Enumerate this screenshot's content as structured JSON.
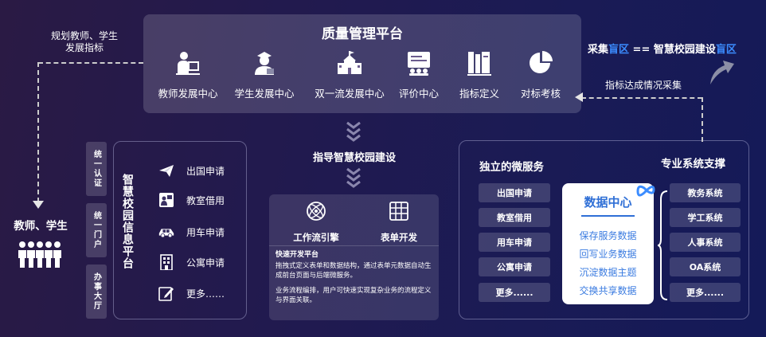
{
  "platform": {
    "title": "质量管理平台",
    "items": [
      {
        "label": "教师发展中心",
        "icon": "teacher-icon"
      },
      {
        "label": "学生发展中心",
        "icon": "student-icon"
      },
      {
        "label": "双一流发展中心",
        "icon": "school-building-icon"
      },
      {
        "label": "评价中心",
        "icon": "evaluation-icon"
      },
      {
        "label": "指标定义",
        "icon": "books-icon"
      },
      {
        "label": "对标考核",
        "icon": "pie-chart-icon"
      }
    ]
  },
  "left_note": {
    "line1": "规划教师、学生",
    "line2": "发展指标"
  },
  "right_note": {
    "collect_prefix": "采集",
    "collect_blind": "盲区",
    "collect_equals": " == ",
    "collect_build": "智慧校园建设",
    "collect_blind2": "盲区",
    "indicator": "指标达成情况采集"
  },
  "people": {
    "label": "教师、学生",
    "icon": "people-group-icon"
  },
  "tabs": [
    {
      "label": "统一认证"
    },
    {
      "label": "统一门户"
    },
    {
      "label": "办事大厅"
    }
  ],
  "smart_platform": {
    "title": "智慧校园信息平台",
    "apps": [
      {
        "label": "出国申请",
        "icon": "airplane-icon"
      },
      {
        "label": "教室借用",
        "icon": "classroom-icon"
      },
      {
        "label": "用车申请",
        "icon": "car-icon"
      },
      {
        "label": "公寓申请",
        "icon": "apartment-icon"
      },
      {
        "label": "更多……",
        "icon": "edit-icon"
      }
    ]
  },
  "guide": {
    "title": "指导智慧校园建设"
  },
  "dev_platform": {
    "workflow_label": "工作流引擎",
    "form_label": "表单开发",
    "heading": "快速开发平台",
    "para1": "拖拽式定义表单和数据结构，通过表单元数据自动生成前台页面与后端微服务。",
    "para2": "业务流程编排，用户可快速实现复杂业务的流程定义与界面关联。"
  },
  "micro_services": {
    "title": "独立的微服务",
    "items": [
      "出国申请",
      "教室借用",
      "用车申请",
      "公寓申请",
      "更多......"
    ]
  },
  "data_center": {
    "title": "数据中心",
    "items": [
      "保存服务数据",
      "回写业务数据",
      "沉淀数据主题",
      "交换共享数据"
    ]
  },
  "systems": {
    "title": "专业系统支撑",
    "items": [
      "教务系统",
      "学工系统",
      "人事系统",
      "OA系统",
      "更多......"
    ]
  },
  "colors": {
    "accent_blue": "#3b8cff",
    "data_center_blue": "#2f6fd6"
  }
}
